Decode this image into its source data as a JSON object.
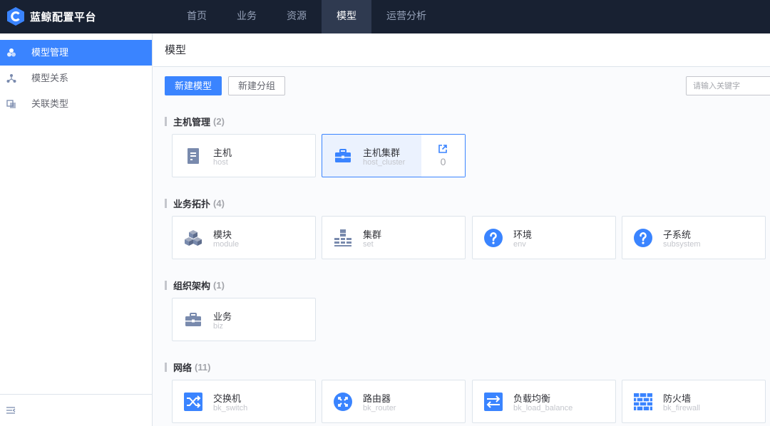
{
  "app": {
    "name": "蓝鲸配置平台",
    "nav": [
      "首页",
      "业务",
      "资源",
      "模型",
      "运营分析"
    ],
    "active_nav": "模型"
  },
  "sidebar": {
    "items": [
      {
        "label": "模型管理",
        "icon": "model-manage-icon",
        "active": true
      },
      {
        "label": "模型关系",
        "icon": "model-relation-icon",
        "active": false
      },
      {
        "label": "关联类型",
        "icon": "association-type-icon",
        "active": false
      }
    ],
    "collapse_icon": "collapse-menu-icon"
  },
  "main": {
    "title": "模型",
    "buttons": {
      "new_model": "新建模型",
      "new_group": "新建分组"
    },
    "search": {
      "placeholder": "请输入关键字",
      "value": ""
    },
    "groups": [
      {
        "name": "主机管理",
        "count": "(2)",
        "models": [
          {
            "name": "主机",
            "id": "host",
            "icon": "server-icon"
          },
          {
            "name": "主机集群",
            "id": "host_cluster",
            "icon": "briefcase-icon",
            "hover": true,
            "instance_count": "0",
            "side_icon": "external-link-icon"
          }
        ]
      },
      {
        "name": "业务拓扑",
        "count": "(4)",
        "models": [
          {
            "name": "模块",
            "id": "module",
            "icon": "cubes-icon"
          },
          {
            "name": "集群",
            "id": "set",
            "icon": "set-topology-icon"
          },
          {
            "name": "环境",
            "id": "env",
            "icon": "question-circle-icon"
          },
          {
            "name": "子系统",
            "id": "subsystem",
            "icon": "question-circle-icon"
          }
        ]
      },
      {
        "name": "组织架构",
        "count": "(1)",
        "models": [
          {
            "name": "业务",
            "id": "biz",
            "icon": "briefcase-icon"
          }
        ]
      },
      {
        "name": "网络",
        "count": "(11)",
        "models": [
          {
            "name": "交换机",
            "id": "bk_switch",
            "icon": "switch-icon"
          },
          {
            "name": "路由器",
            "id": "bk_router",
            "icon": "router-icon"
          },
          {
            "name": "负载均衡",
            "id": "bk_load_balance",
            "icon": "load-balance-icon"
          },
          {
            "name": "防火墙",
            "id": "bk_firewall",
            "icon": "firewall-icon"
          }
        ]
      }
    ]
  },
  "colors": {
    "primary": "#3a84ff",
    "topbar": "#182132",
    "icon_gray": "#798aad"
  }
}
